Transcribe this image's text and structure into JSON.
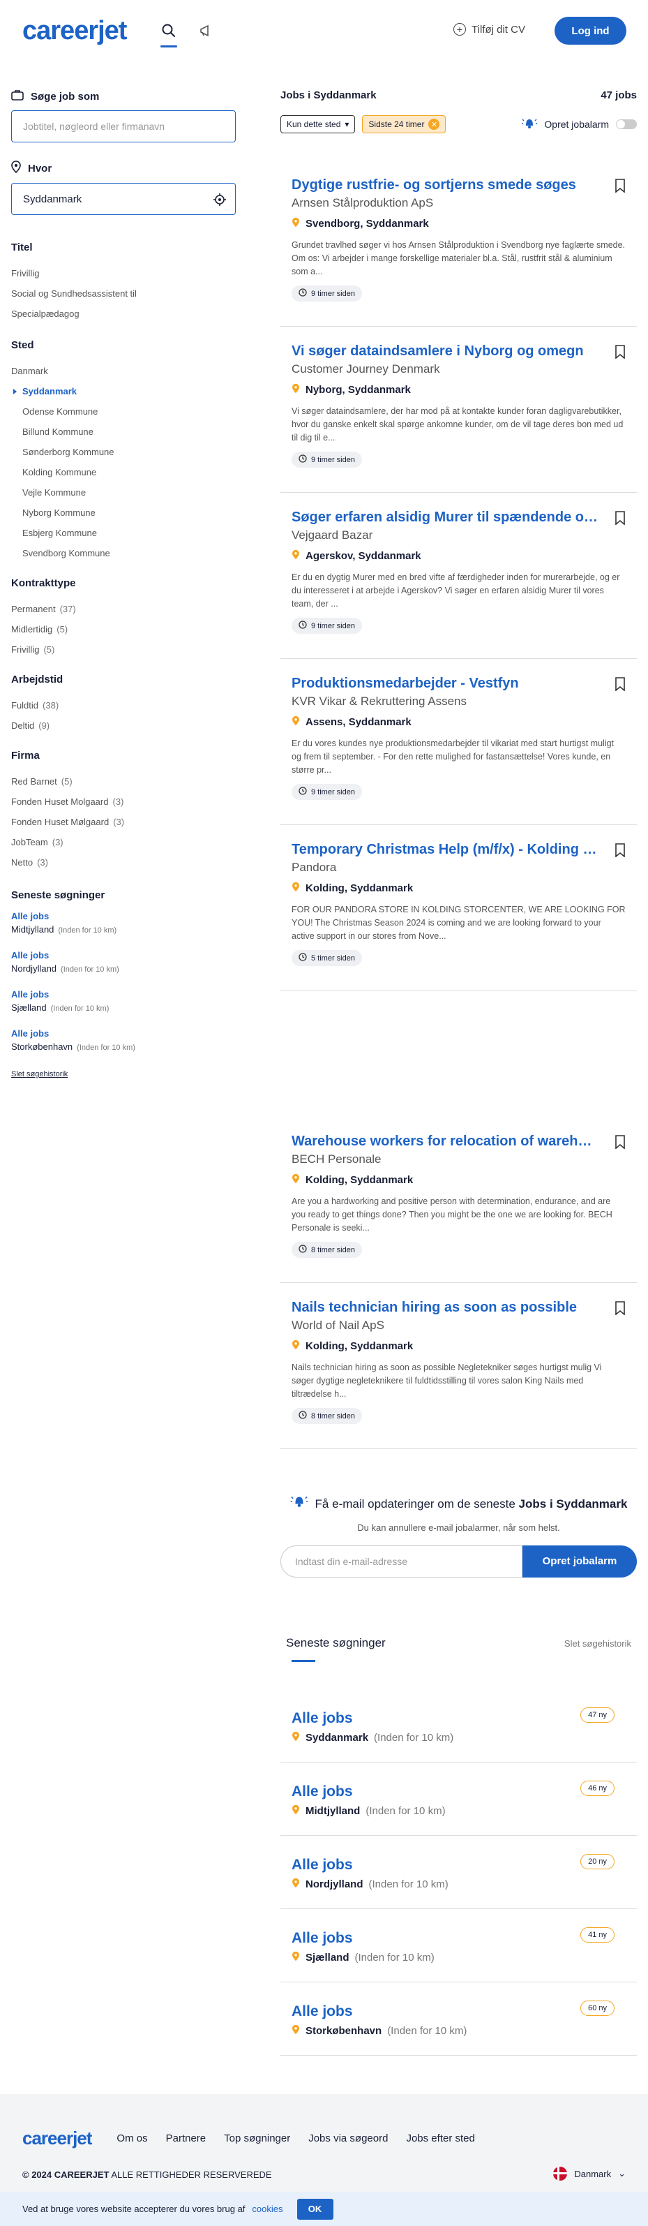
{
  "header": {
    "logo": "careerjet",
    "add_cv": "Tilføj dit CV",
    "login": "Log ind"
  },
  "sidebar": {
    "search_label": "Søge job som",
    "search_placeholder": "Jobtitel, nøgleord eller firmanavn",
    "where_label": "Hvor",
    "where_value": "Syddanmark",
    "title_facet": {
      "heading": "Titel",
      "items": [
        "Frivillig",
        "Social og Sundhedsassistent til",
        "Specialpædagog"
      ]
    },
    "place_facet": {
      "heading": "Sted",
      "items": [
        {
          "label": "Danmark"
        },
        {
          "label": "Syddanmark",
          "active": true
        },
        {
          "label": "Odense Kommune"
        },
        {
          "label": "Billund Kommune"
        },
        {
          "label": "Sønderborg Kommune"
        },
        {
          "label": "Kolding Kommune"
        },
        {
          "label": "Vejle Kommune"
        },
        {
          "label": "Nyborg Kommune"
        },
        {
          "label": "Esbjerg Kommune"
        },
        {
          "label": "Svendborg Kommune"
        }
      ]
    },
    "contract_facet": {
      "heading": "Kontrakttype",
      "items": [
        {
          "label": "Permanent",
          "count": "(37)"
        },
        {
          "label": "Midlertidig",
          "count": "(5)"
        },
        {
          "label": "Frivillig",
          "count": "(5)"
        }
      ]
    },
    "hours_facet": {
      "heading": "Arbejdstid",
      "items": [
        {
          "label": "Fuldtid",
          "count": "(38)"
        },
        {
          "label": "Deltid",
          "count": "(9)"
        }
      ]
    },
    "company_facet": {
      "heading": "Firma",
      "items": [
        {
          "label": "Red Barnet",
          "count": "(5)"
        },
        {
          "label": "Fonden Huset Molgaard",
          "count": "(3)"
        },
        {
          "label": "Fonden Huset Mølgaard",
          "count": "(3)"
        },
        {
          "label": "JobTeam",
          "count": "(3)"
        },
        {
          "label": "Netto",
          "count": "(3)"
        }
      ]
    },
    "recent": {
      "heading": "Seneste søgninger",
      "items": [
        {
          "title": "Alle jobs",
          "loc": "Midtjylland",
          "radius": "(Inden for 10 km)"
        },
        {
          "title": "Alle jobs",
          "loc": "Nordjylland",
          "radius": "(Inden for 10 km)"
        },
        {
          "title": "Alle jobs",
          "loc": "Sjælland",
          "radius": "(Inden for 10 km)"
        },
        {
          "title": "Alle jobs",
          "loc": "Storkøbenhavn",
          "radius": "(Inden for 10 km)"
        }
      ],
      "clear": "Slet søgehistorik"
    }
  },
  "main": {
    "heading": "Jobs i Syddanmark",
    "count": "47 jobs",
    "filter_place": "Kun dette sted",
    "filter_time": "Sidste 24 timer",
    "alarm_label": "Opret jobalarm",
    "jobs": [
      {
        "title": "Dygtige rustfrie- og sortjerns smede søges",
        "company": "Arnsen Stålproduktion ApS",
        "location": "Svendborg, Syddanmark",
        "desc": "Grundet travlhed søger vi hos Arnsen Stålproduktion i Svendborg nye faglærte smede. Om os: Vi arbejder i mange forskellige materialer bl.a. Stål, rustfrit stål & aluminium som a...",
        "time": "9 timer siden"
      },
      {
        "title": "Vi søger dataindsamlere i Nyborg og omegn",
        "company": "Customer Journey Denmark",
        "location": "Nyborg, Syddanmark",
        "desc": "Vi søger dataindsamlere, der har mod på at kontakte kunder foran dagligvarebutikker, hvor du ganske enkelt skal spørge ankomne kunder, om de vil tage deres bon med ud til dig til e...",
        "time": "9 timer siden"
      },
      {
        "title": "Søger erfaren alsidig Murer til spændende opgaver",
        "company": "Vejgaard Bazar",
        "location": "Agerskov, Syddanmark",
        "desc": "Er du en dygtig Murer med en bred vifte af færdigheder inden for murerarbejde, og er du interesseret i at arbejde i Agerskov? Vi søger en erfaren alsidig Murer til vores team, der ...",
        "time": "9 timer siden"
      },
      {
        "title": "Produktionsmedarbejder - Vestfyn",
        "company": "KVR Vikar & Rekruttering Assens",
        "location": "Assens, Syddanmark",
        "desc": "Er du vores kundes nye produktionsmedarbejder til vikariat med start hurtigst muligt og frem til september. - For den rette mulighed for fastansættelse! Vores kunde, en større pr...",
        "time": "9 timer siden"
      },
      {
        "title": "Temporary Christmas Help (m/f/x) - Kolding Storcenter",
        "company": "Pandora",
        "location": "Kolding, Syddanmark",
        "desc": "FOR OUR PANDORA STORE IN KOLDING STORCENTER, WE ARE LOOKING FOR YOU! The Christmas Season 2024 is coming and we are looking forward to your active support in our stores from Nove...",
        "time": "5 timer siden"
      },
      {
        "title": "Warehouse workers for relocation of warehouse",
        "company": "BECH Personale",
        "location": "Kolding, Syddanmark",
        "desc": "Are you a hardworking and positive person with determination, endurance, and are you ready to get things done? Then you might be the one we are looking for. BECH Personale is seeki...",
        "time": "8 timer siden"
      },
      {
        "title": "Nails technician hiring as soon as possible",
        "company": "World of Nail ApS",
        "location": "Kolding, Syddanmark",
        "desc": "Nails technician hiring as soon as possible Negletekniker søges hurtigst mulig Vi søger dygtige negleteknikere til fuldtidsstilling til vores salon King Nails med tiltrædelse h...",
        "time": "8 timer siden"
      }
    ]
  },
  "alert": {
    "title_pre": "Få e-mail opdateringer om de seneste",
    "title_bold": "Jobs i Syddanmark",
    "sub": "Du kan annullere e-mail jobalarmer, når som helst.",
    "placeholder": "Indtast din e-mail-adresse",
    "button": "Opret jobalarm"
  },
  "recent_main": {
    "heading": "Seneste søgninger",
    "clear": "Slet søgehistorik",
    "items": [
      {
        "title": "Alle jobs",
        "loc": "Syddanmark",
        "radius": "(Inden for 10 km)",
        "badge": "47 ny"
      },
      {
        "title": "Alle jobs",
        "loc": "Midtjylland",
        "radius": "(Inden for 10 km)",
        "badge": "46 ny"
      },
      {
        "title": "Alle jobs",
        "loc": "Nordjylland",
        "radius": "(Inden for 10 km)",
        "badge": "20 ny"
      },
      {
        "title": "Alle jobs",
        "loc": "Sjælland",
        "radius": "(Inden for 10 km)",
        "badge": "41 ny"
      },
      {
        "title": "Alle jobs",
        "loc": "Storkøbenhavn",
        "radius": "(Inden for 10 km)",
        "badge": "60 ny"
      }
    ]
  },
  "footer": {
    "logo": "careerjet",
    "links": [
      "Om os",
      "Partnere",
      "Top søgninger",
      "Jobs via søgeord",
      "Jobs efter sted"
    ],
    "copy_year": "© 2024 CAREERJET",
    "copy_rest": "ALLE RETTIGHEDER RESERVEREDE",
    "country": "Danmark"
  },
  "cookie": {
    "text": "Ved at bruge vores website accepterer du vores brug af",
    "link": "cookies",
    "ok": "OK"
  },
  "colors": {
    "brand": "#1d63c6",
    "accent": "#f5a623"
  }
}
